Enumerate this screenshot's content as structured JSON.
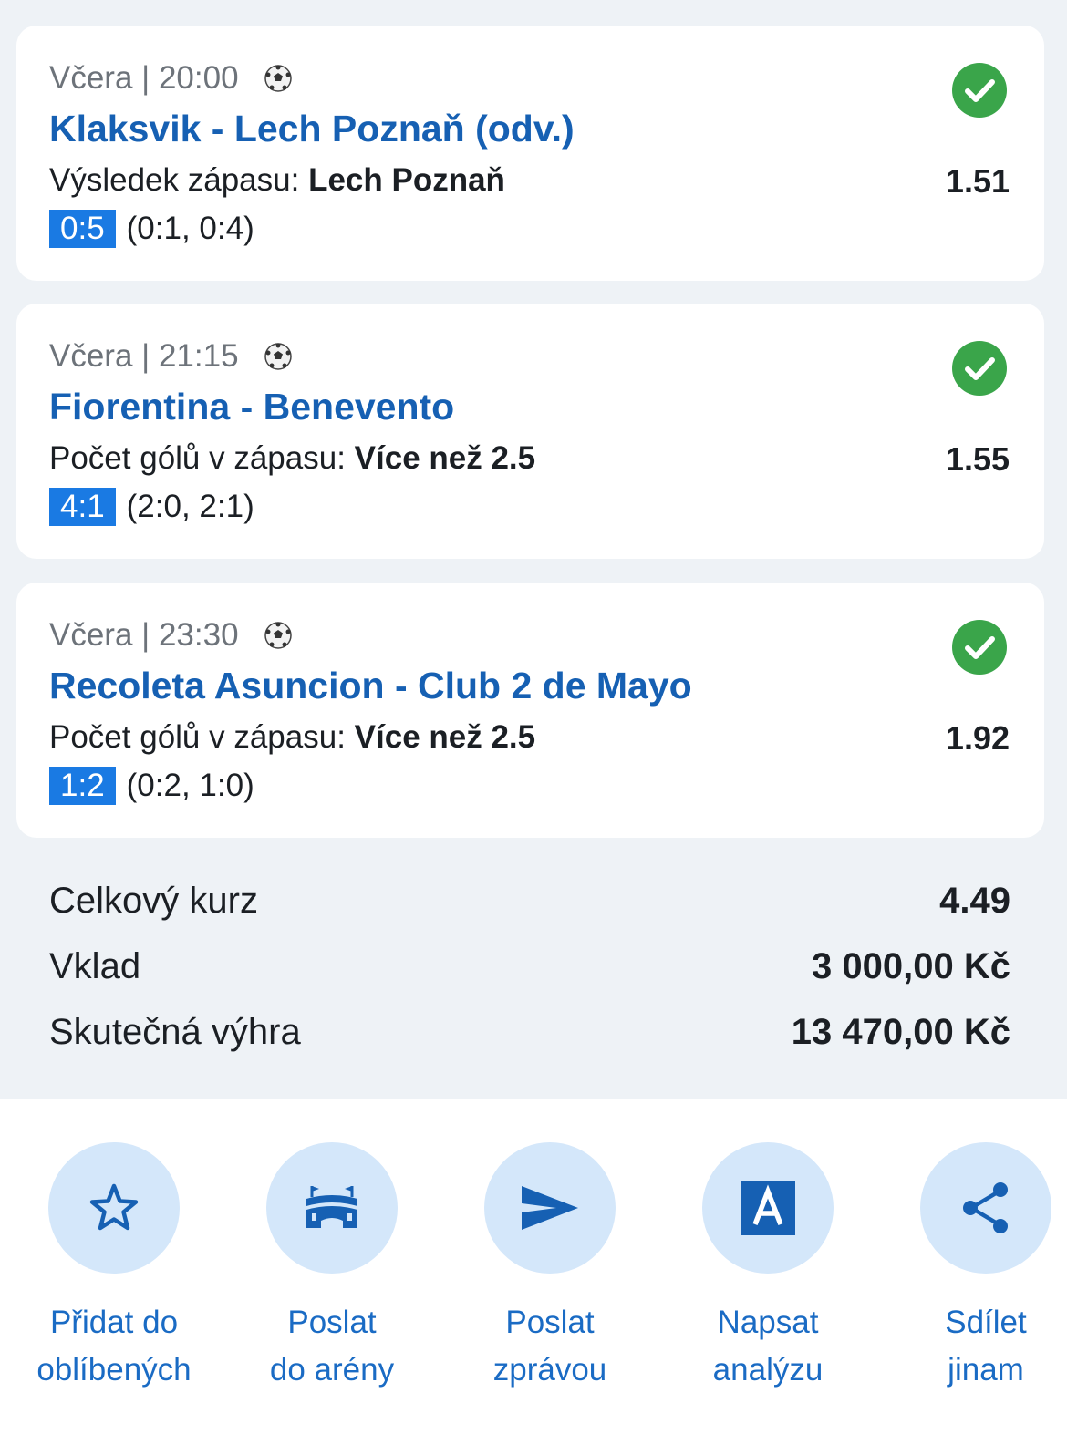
{
  "bets": [
    {
      "datetime": "Včera | 20:00",
      "teams": "Klaksvik - Lech Poznaň (odv.)",
      "market_label": "Výsledek zápasu:",
      "market_pick": "Lech Poznaň",
      "odds": "1.51",
      "score": "0:5",
      "halves": "(0:1, 0:4)",
      "status": "won"
    },
    {
      "datetime": "Včera | 21:15",
      "teams": "Fiorentina - Benevento",
      "market_label": "Počet gólů v zápasu:",
      "market_pick": "Více než 2.5",
      "odds": "1.55",
      "score": "4:1",
      "halves": "(2:0, 2:1)",
      "status": "won"
    },
    {
      "datetime": "Včera | 23:30",
      "teams": "Recoleta Asuncion - Club 2 de Mayo",
      "market_label": "Počet gólů v zápasu:",
      "market_pick": "Více než 2.5",
      "odds": "1.92",
      "score": "1:2",
      "halves": "(0:2, 1:0)",
      "status": "won"
    }
  ],
  "summary": {
    "total_odds_label": "Celkový kurz",
    "total_odds": "4.49",
    "stake_label": "Vklad",
    "stake": "3 000,00 Kč",
    "win_label": "Skutečná výhra",
    "win": "13 470,00 Kč"
  },
  "actions": [
    {
      "icon": "star-icon",
      "line1": "Přidat do",
      "line2": "oblíbených"
    },
    {
      "icon": "arena-icon",
      "line1": "Poslat",
      "line2": "do arény"
    },
    {
      "icon": "send-icon",
      "line1": "Poslat",
      "line2": "zprávou"
    },
    {
      "icon": "analysis-icon",
      "line1": "Napsat",
      "line2": "analýzu"
    },
    {
      "icon": "share-icon",
      "line1": "Sdílet",
      "line2": "jinam"
    }
  ],
  "colors": {
    "accent_blue": "#1660b3",
    "score_badge": "#1a7ae3",
    "success_green": "#3aa54a",
    "action_circle": "#d4e7fa",
    "background": "#eef2f6"
  }
}
